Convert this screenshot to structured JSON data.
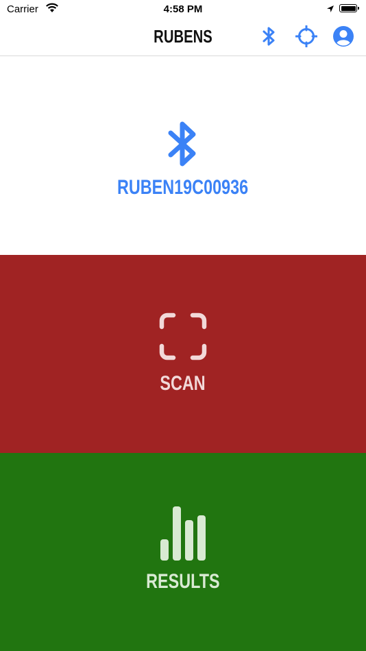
{
  "status_bar": {
    "carrier": "Carrier",
    "time": "4:58 PM",
    "icons": [
      "wifi-icon",
      "location-arrow-icon",
      "battery-icon"
    ]
  },
  "nav": {
    "title": "RUBENS",
    "accent_color": "#3b82f6",
    "buttons": [
      "bluetooth-icon",
      "crosshair-icon",
      "user-circle-icon"
    ]
  },
  "device": {
    "name": "RUBEN19C00936",
    "icon": "bluetooth-icon",
    "color": "#3b82f6"
  },
  "scan": {
    "label": "SCAN",
    "icon": "scan-frame-icon",
    "background": "#a02323",
    "foreground": "#f2d9d9"
  },
  "results": {
    "label": "RESULTS",
    "icon": "bar-chart-icon",
    "background": "#217510",
    "foreground": "#d9ead3"
  }
}
